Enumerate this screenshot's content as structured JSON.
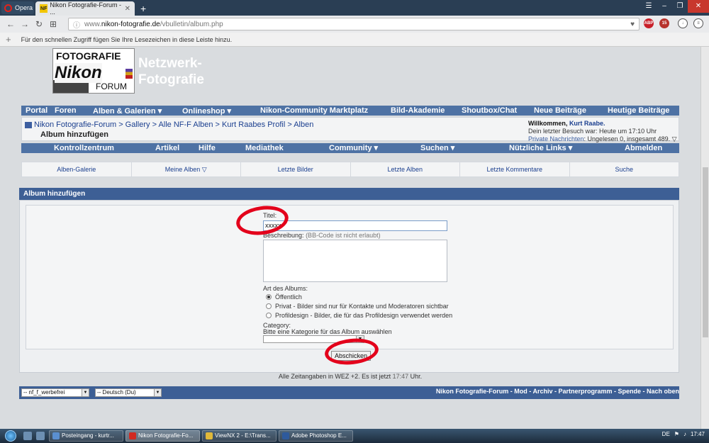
{
  "browser": {
    "menu_label": "Opera",
    "tab_title": "Nikon Fotografie-Forum - ...",
    "tab_favicon_text": "NF",
    "url_prefix": "www.",
    "url_domain": "nikon-fotografie.de",
    "url_path": "/vbulletin/album.php",
    "bookmarks_hint": "Für den schnellen Zugriff fügen Sie Ihre Lesezeichen in diese Leiste hinzu.",
    "extensions": [
      "ABP",
      "15"
    ]
  },
  "header": {
    "logo_top": "FOTOGRAFIE",
    "logo_main": "Nikon",
    "logo_bottom": "FORUM",
    "tagline_1": "Netzwerk-",
    "tagline_2": "Fotografie"
  },
  "nav1": [
    "Portal",
    "Foren",
    "Alben & Galerien ▾",
    "Onlineshop ▾",
    "Nikon-Community Marktplatz",
    "Bild-Akademie",
    "Shoutbox/Chat",
    "Neue Beiträge",
    "Heutige Beiträge"
  ],
  "breadcrumb": {
    "path": "Nikon Fotografie-Forum > Gallery > Alle NF-F Alben > Kurt Raabes Profil > Alben",
    "current": "Album hinzufügen"
  },
  "welcome": {
    "greeting": "Willkommen, ",
    "name": "Kurt Raabe.",
    "last_visit": "Dein letzter Besuch war: Heute um 17:10 Uhr",
    "pm_label": "Private Nachrichten",
    "pm_text": ": Ungelesen 0, insgesamt 489. ▽"
  },
  "nav2": [
    "Kontrollzentrum",
    "Artikel",
    "Hilfe",
    "Mediathek",
    "Community ▾",
    "Suchen ▾",
    "Nützliche Links ▾",
    "Abmelden"
  ],
  "subnav": [
    "Alben-Galerie",
    "Meine Alben ▽",
    "Letzte Bilder",
    "Letzte Alben",
    "Letzte Kommentare",
    "Suche"
  ],
  "form": {
    "heading": "Album hinzufügen",
    "title_label": "Titel:",
    "title_value": "xxxxx",
    "desc_label": "Beschreibung:",
    "desc_hint": "(BB-Code ist nicht erlaubt)",
    "type_label": "Art des Albums:",
    "options": [
      {
        "label": "Öffentlich",
        "checked": true
      },
      {
        "label": "Privat - Bilder sind nur für Kontakte und Moderatoren sichtbar",
        "checked": false
      },
      {
        "label": "Profildesign - Bilder, die für das Profildesign verwendet werden",
        "checked": false
      }
    ],
    "category_label": "Category:",
    "category_hint": "Bitte eine Kategorie für das Album auswählen",
    "submit": "Abschicken"
  },
  "timezone": {
    "prefix": "Alle Zeitangaben in WEZ +2. Es ist jetzt ",
    "time": "17:47",
    "suffix": " Uhr."
  },
  "footer": {
    "style_select": "-- nf_f_werbefrei",
    "lang_select": "-- Deutsch (Du)",
    "links": "Nikon Fotografie-Forum - Mod - Archiv - Partnerprogramm - Spende - Nach oben"
  },
  "taskbar": {
    "items": [
      "Posteingang - kurtr...",
      "Nikon Fotografie-Fo...",
      "ViewNX 2 - E:\\Trans...",
      "Adobe Photoshop E..."
    ],
    "lang": "DE",
    "clock": "17:47"
  },
  "colors": {
    "nav": "#4e72a4",
    "header_bar": "#3d5f95",
    "annotation": "#e3001b"
  }
}
